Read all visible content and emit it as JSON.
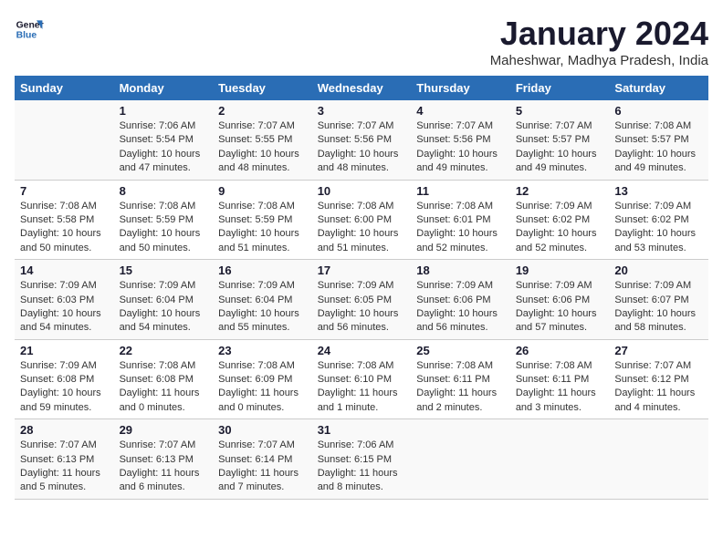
{
  "logo": {
    "line1": "General",
    "line2": "Blue"
  },
  "title": "January 2024",
  "location": "Maheshwar, Madhya Pradesh, India",
  "headers": [
    "Sunday",
    "Monday",
    "Tuesday",
    "Wednesday",
    "Thursday",
    "Friday",
    "Saturday"
  ],
  "weeks": [
    [
      {
        "day": "",
        "sunrise": "",
        "sunset": "",
        "daylight": ""
      },
      {
        "day": "1",
        "sunrise": "Sunrise: 7:06 AM",
        "sunset": "Sunset: 5:54 PM",
        "daylight": "Daylight: 10 hours and 47 minutes."
      },
      {
        "day": "2",
        "sunrise": "Sunrise: 7:07 AM",
        "sunset": "Sunset: 5:55 PM",
        "daylight": "Daylight: 10 hours and 48 minutes."
      },
      {
        "day": "3",
        "sunrise": "Sunrise: 7:07 AM",
        "sunset": "Sunset: 5:56 PM",
        "daylight": "Daylight: 10 hours and 48 minutes."
      },
      {
        "day": "4",
        "sunrise": "Sunrise: 7:07 AM",
        "sunset": "Sunset: 5:56 PM",
        "daylight": "Daylight: 10 hours and 49 minutes."
      },
      {
        "day": "5",
        "sunrise": "Sunrise: 7:07 AM",
        "sunset": "Sunset: 5:57 PM",
        "daylight": "Daylight: 10 hours and 49 minutes."
      },
      {
        "day": "6",
        "sunrise": "Sunrise: 7:08 AM",
        "sunset": "Sunset: 5:57 PM",
        "daylight": "Daylight: 10 hours and 49 minutes."
      }
    ],
    [
      {
        "day": "7",
        "sunrise": "Sunrise: 7:08 AM",
        "sunset": "Sunset: 5:58 PM",
        "daylight": "Daylight: 10 hours and 50 minutes."
      },
      {
        "day": "8",
        "sunrise": "Sunrise: 7:08 AM",
        "sunset": "Sunset: 5:59 PM",
        "daylight": "Daylight: 10 hours and 50 minutes."
      },
      {
        "day": "9",
        "sunrise": "Sunrise: 7:08 AM",
        "sunset": "Sunset: 5:59 PM",
        "daylight": "Daylight: 10 hours and 51 minutes."
      },
      {
        "day": "10",
        "sunrise": "Sunrise: 7:08 AM",
        "sunset": "Sunset: 6:00 PM",
        "daylight": "Daylight: 10 hours and 51 minutes."
      },
      {
        "day": "11",
        "sunrise": "Sunrise: 7:08 AM",
        "sunset": "Sunset: 6:01 PM",
        "daylight": "Daylight: 10 hours and 52 minutes."
      },
      {
        "day": "12",
        "sunrise": "Sunrise: 7:09 AM",
        "sunset": "Sunset: 6:02 PM",
        "daylight": "Daylight: 10 hours and 52 minutes."
      },
      {
        "day": "13",
        "sunrise": "Sunrise: 7:09 AM",
        "sunset": "Sunset: 6:02 PM",
        "daylight": "Daylight: 10 hours and 53 minutes."
      }
    ],
    [
      {
        "day": "14",
        "sunrise": "Sunrise: 7:09 AM",
        "sunset": "Sunset: 6:03 PM",
        "daylight": "Daylight: 10 hours and 54 minutes."
      },
      {
        "day": "15",
        "sunrise": "Sunrise: 7:09 AM",
        "sunset": "Sunset: 6:04 PM",
        "daylight": "Daylight: 10 hours and 54 minutes."
      },
      {
        "day": "16",
        "sunrise": "Sunrise: 7:09 AM",
        "sunset": "Sunset: 6:04 PM",
        "daylight": "Daylight: 10 hours and 55 minutes."
      },
      {
        "day": "17",
        "sunrise": "Sunrise: 7:09 AM",
        "sunset": "Sunset: 6:05 PM",
        "daylight": "Daylight: 10 hours and 56 minutes."
      },
      {
        "day": "18",
        "sunrise": "Sunrise: 7:09 AM",
        "sunset": "Sunset: 6:06 PM",
        "daylight": "Daylight: 10 hours and 56 minutes."
      },
      {
        "day": "19",
        "sunrise": "Sunrise: 7:09 AM",
        "sunset": "Sunset: 6:06 PM",
        "daylight": "Daylight: 10 hours and 57 minutes."
      },
      {
        "day": "20",
        "sunrise": "Sunrise: 7:09 AM",
        "sunset": "Sunset: 6:07 PM",
        "daylight": "Daylight: 10 hours and 58 minutes."
      }
    ],
    [
      {
        "day": "21",
        "sunrise": "Sunrise: 7:09 AM",
        "sunset": "Sunset: 6:08 PM",
        "daylight": "Daylight: 10 hours and 59 minutes."
      },
      {
        "day": "22",
        "sunrise": "Sunrise: 7:08 AM",
        "sunset": "Sunset: 6:08 PM",
        "daylight": "Daylight: 11 hours and 0 minutes."
      },
      {
        "day": "23",
        "sunrise": "Sunrise: 7:08 AM",
        "sunset": "Sunset: 6:09 PM",
        "daylight": "Daylight: 11 hours and 0 minutes."
      },
      {
        "day": "24",
        "sunrise": "Sunrise: 7:08 AM",
        "sunset": "Sunset: 6:10 PM",
        "daylight": "Daylight: 11 hours and 1 minute."
      },
      {
        "day": "25",
        "sunrise": "Sunrise: 7:08 AM",
        "sunset": "Sunset: 6:11 PM",
        "daylight": "Daylight: 11 hours and 2 minutes."
      },
      {
        "day": "26",
        "sunrise": "Sunrise: 7:08 AM",
        "sunset": "Sunset: 6:11 PM",
        "daylight": "Daylight: 11 hours and 3 minutes."
      },
      {
        "day": "27",
        "sunrise": "Sunrise: 7:07 AM",
        "sunset": "Sunset: 6:12 PM",
        "daylight": "Daylight: 11 hours and 4 minutes."
      }
    ],
    [
      {
        "day": "28",
        "sunrise": "Sunrise: 7:07 AM",
        "sunset": "Sunset: 6:13 PM",
        "daylight": "Daylight: 11 hours and 5 minutes."
      },
      {
        "day": "29",
        "sunrise": "Sunrise: 7:07 AM",
        "sunset": "Sunset: 6:13 PM",
        "daylight": "Daylight: 11 hours and 6 minutes."
      },
      {
        "day": "30",
        "sunrise": "Sunrise: 7:07 AM",
        "sunset": "Sunset: 6:14 PM",
        "daylight": "Daylight: 11 hours and 7 minutes."
      },
      {
        "day": "31",
        "sunrise": "Sunrise: 7:06 AM",
        "sunset": "Sunset: 6:15 PM",
        "daylight": "Daylight: 11 hours and 8 minutes."
      },
      {
        "day": "",
        "sunrise": "",
        "sunset": "",
        "daylight": ""
      },
      {
        "day": "",
        "sunrise": "",
        "sunset": "",
        "daylight": ""
      },
      {
        "day": "",
        "sunrise": "",
        "sunset": "",
        "daylight": ""
      }
    ]
  ]
}
